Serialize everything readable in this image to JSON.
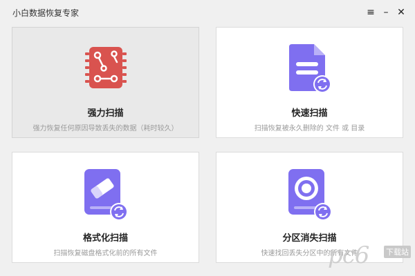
{
  "window": {
    "title": "小白数据恢复专家",
    "menu_glyph": "≡",
    "minimize_glyph": "–",
    "close_glyph": "✕"
  },
  "cards": [
    {
      "title": "强力扫描",
      "desc": "强力恢复任何原因导致丢失的数据（耗时较久）",
      "icon": "chip-circuit-icon",
      "color": "#d9534f"
    },
    {
      "title": "快速扫描",
      "desc": "扫描恢复被永久删除的 文件 或 目录",
      "icon": "document-refresh-icon",
      "color": "#7f6ff0"
    },
    {
      "title": "格式化扫描",
      "desc": "扫描恢复磁盘格式化前的所有文件",
      "icon": "disk-eraser-icon",
      "color": "#7f6ff0"
    },
    {
      "title": "分区消失扫描",
      "desc": "快速找回丢失分区中的所有文件",
      "icon": "disk-speaker-icon",
      "color": "#7f6ff0"
    }
  ],
  "watermark": {
    "text": "pc6",
    "badge": "下载站"
  }
}
